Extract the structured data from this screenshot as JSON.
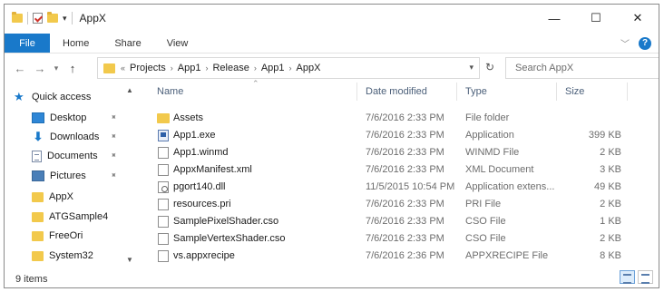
{
  "window": {
    "title": "AppX",
    "controls": {
      "minimize": "—",
      "maximize": "☐",
      "close": "✕"
    }
  },
  "ribbon": {
    "tabs": [
      "File",
      "Home",
      "Share",
      "View"
    ],
    "help": "?"
  },
  "address": {
    "overflow": "«",
    "crumbs": [
      "Projects",
      "App1",
      "Release",
      "App1",
      "AppX"
    ]
  },
  "search": {
    "placeholder": "Search AppX"
  },
  "nav": {
    "quick_access": "Quick access",
    "items": [
      {
        "label": "Desktop",
        "icon": "desktop-icon",
        "pinned": true
      },
      {
        "label": "Downloads",
        "icon": "download-icon",
        "pinned": true
      },
      {
        "label": "Documents",
        "icon": "document-icon",
        "pinned": true
      },
      {
        "label": "Pictures",
        "icon": "pictures-icon",
        "pinned": true
      },
      {
        "label": "AppX",
        "icon": "folder-icon",
        "pinned": false
      },
      {
        "label": "ATGSample4",
        "icon": "folder-icon",
        "pinned": false
      },
      {
        "label": "FreeOri",
        "icon": "folder-icon",
        "pinned": false
      },
      {
        "label": "System32",
        "icon": "folder-icon",
        "pinned": false
      }
    ]
  },
  "files": {
    "columns": {
      "name": "Name",
      "date": "Date modified",
      "type": "Type",
      "size": "Size"
    },
    "rows": [
      {
        "name": "Assets",
        "date": "7/6/2016 2:33 PM",
        "type": "File folder",
        "size": "",
        "icon": "folder"
      },
      {
        "name": "App1.exe",
        "date": "7/6/2016 2:33 PM",
        "type": "Application",
        "size": "399 KB",
        "icon": "exe"
      },
      {
        "name": "App1.winmd",
        "date": "7/6/2016 2:33 PM",
        "type": "WINMD File",
        "size": "2 KB",
        "icon": "file"
      },
      {
        "name": "AppxManifest.xml",
        "date": "7/6/2016 2:33 PM",
        "type": "XML Document",
        "size": "3 KB",
        "icon": "file"
      },
      {
        "name": "pgort140.dll",
        "date": "11/5/2015 10:54 PM",
        "type": "Application extens...",
        "size": "49 KB",
        "icon": "dll"
      },
      {
        "name": "resources.pri",
        "date": "7/6/2016 2:33 PM",
        "type": "PRI File",
        "size": "2 KB",
        "icon": "file"
      },
      {
        "name": "SamplePixelShader.cso",
        "date": "7/6/2016 2:33 PM",
        "type": "CSO File",
        "size": "1 KB",
        "icon": "file"
      },
      {
        "name": "SampleVertexShader.cso",
        "date": "7/6/2016 2:33 PM",
        "type": "CSO File",
        "size": "2 KB",
        "icon": "file"
      },
      {
        "name": "vs.appxrecipe",
        "date": "7/6/2016 2:36 PM",
        "type": "APPXRECIPE File",
        "size": "8 KB",
        "icon": "file"
      }
    ]
  },
  "status": {
    "item_count": "9 items"
  },
  "colors": {
    "accent": "#1979ca",
    "folder": "#f2c94c",
    "header_text": "#4c607a"
  }
}
